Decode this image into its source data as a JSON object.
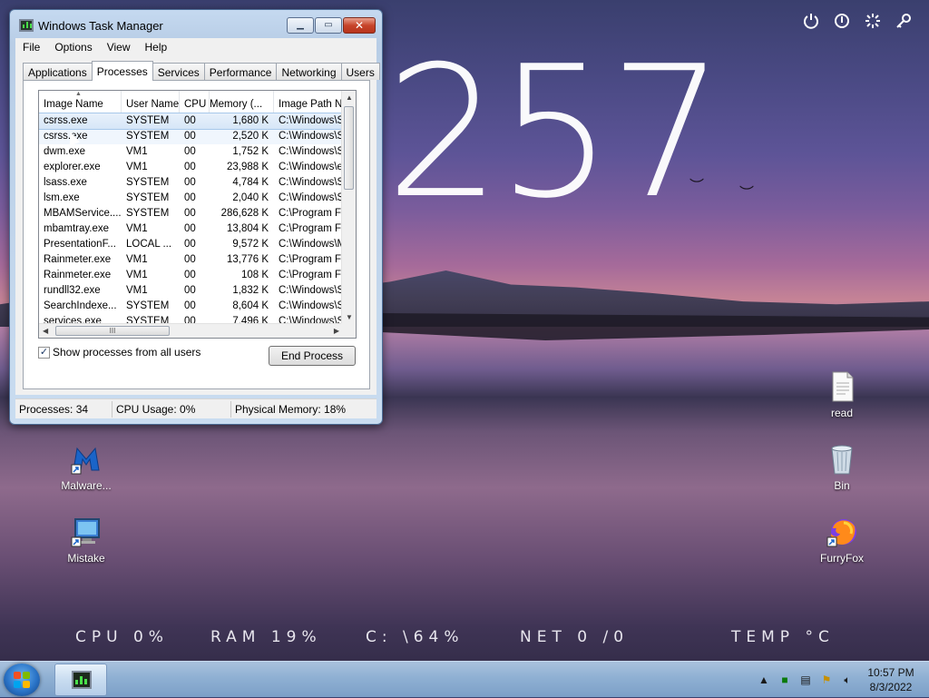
{
  "desktop": {
    "clock_digits": "257",
    "top_icons": [
      "power-icon",
      "shutdown-icon",
      "loading-icon",
      "key-icon"
    ],
    "icons": [
      {
        "label": "Malware...",
        "icon": "malwarebytes-icon"
      },
      {
        "label": "Mistake",
        "icon": "computer-icon"
      },
      {
        "label": "read",
        "icon": "text-file-icon"
      },
      {
        "label": "Bin",
        "icon": "recycle-bin-icon"
      },
      {
        "label": "FurryFox",
        "icon": "firefox-icon"
      }
    ],
    "stats": {
      "cpu": "CPU 0%",
      "ram": "RAM 19%",
      "disk": "C: \\64%",
      "net": "NET 0 /0",
      "temp": "TEMP °C"
    }
  },
  "taskmgr": {
    "title": "Windows Task Manager",
    "menu": [
      "File",
      "Options",
      "View",
      "Help"
    ],
    "tabs": [
      "Applications",
      "Processes",
      "Services",
      "Performance",
      "Networking",
      "Users"
    ],
    "active_tab": "Processes",
    "columns": [
      "Image Name",
      "User Name",
      "CPU",
      "Memory (...",
      "Image Path Na"
    ],
    "rows": [
      {
        "name": "csrss.exe",
        "user": "SYSTEM",
        "cpu": "00",
        "mem": "1,680 K",
        "path": "C:\\Windows\\S"
      },
      {
        "name": "csrss.exe",
        "user": "SYSTEM",
        "cpu": "00",
        "mem": "2,520 K",
        "path": "C:\\Windows\\S"
      },
      {
        "name": "dwm.exe",
        "user": "VM1",
        "cpu": "00",
        "mem": "1,752 K",
        "path": "C:\\Windows\\S"
      },
      {
        "name": "explorer.exe",
        "user": "VM1",
        "cpu": "00",
        "mem": "23,988 K",
        "path": "C:\\Windows\\e"
      },
      {
        "name": "lsass.exe",
        "user": "SYSTEM",
        "cpu": "00",
        "mem": "4,784 K",
        "path": "C:\\Windows\\S"
      },
      {
        "name": "lsm.exe",
        "user": "SYSTEM",
        "cpu": "00",
        "mem": "2,040 K",
        "path": "C:\\Windows\\S"
      },
      {
        "name": "MBAMService....",
        "user": "SYSTEM",
        "cpu": "00",
        "mem": "286,628 K",
        "path": "C:\\Program Fil"
      },
      {
        "name": "mbamtray.exe",
        "user": "VM1",
        "cpu": "00",
        "mem": "13,804 K",
        "path": "C:\\Program Fil"
      },
      {
        "name": "PresentationF...",
        "user": "LOCAL ...",
        "cpu": "00",
        "mem": "9,572 K",
        "path": "C:\\Windows\\M"
      },
      {
        "name": "Rainmeter.exe",
        "user": "VM1",
        "cpu": "00",
        "mem": "13,776 K",
        "path": "C:\\Program Fil"
      },
      {
        "name": "Rainmeter.exe",
        "user": "VM1",
        "cpu": "00",
        "mem": "108 K",
        "path": "C:\\Program Fil"
      },
      {
        "name": "rundll32.exe",
        "user": "VM1",
        "cpu": "00",
        "mem": "1,832 K",
        "path": "C:\\Windows\\S"
      },
      {
        "name": "SearchIndexe...",
        "user": "SYSTEM",
        "cpu": "00",
        "mem": "8,604 K",
        "path": "C:\\Windows\\S"
      },
      {
        "name": "services.exe",
        "user": "SYSTEM",
        "cpu": "00",
        "mem": "7,496 K",
        "path": "C:\\Windows\\S"
      }
    ],
    "show_all_label": "Show processes from all users",
    "show_all_checked": true,
    "end_process_label": "End Process",
    "status": {
      "processes": "Processes: 34",
      "cpu": "CPU Usage: 0%",
      "memory": "Physical Memory: 18%"
    }
  },
  "taskbar": {
    "time": "10:57 PM",
    "date": "8/3/2022"
  }
}
